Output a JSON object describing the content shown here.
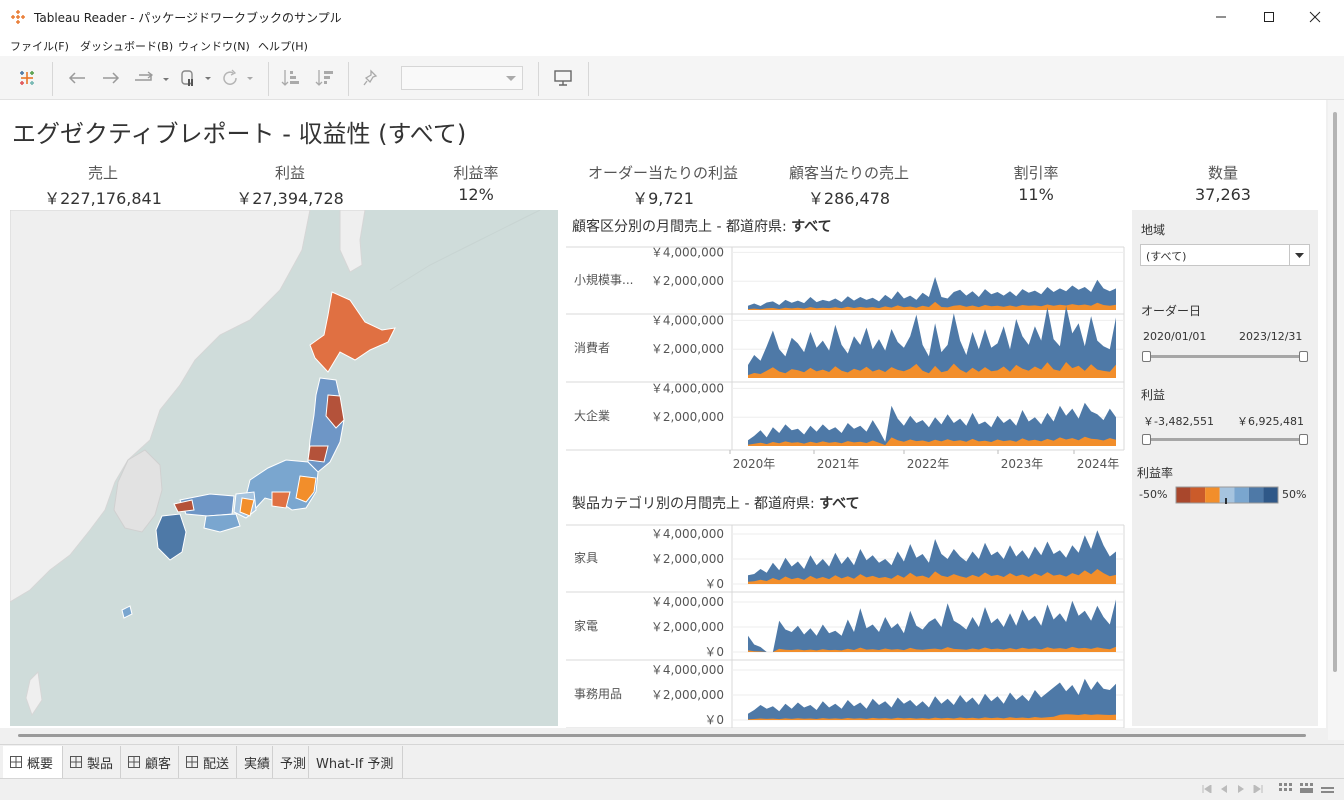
{
  "window": {
    "title": "Tableau Reader - パッケージドワークブックのサンプル"
  },
  "menu": [
    "ファイル(F)",
    "ダッシュボード(B)",
    "ウィンドウ(N)",
    "ヘルプ(H)"
  ],
  "dashboard": {
    "title": "エグゼクティブレポート - 収益性 (すべて)",
    "kpis": [
      {
        "label": "売上",
        "value": "￥227,176,841"
      },
      {
        "label": "利益",
        "value": "￥27,394,728"
      },
      {
        "label": "利益率",
        "value": "12%"
      },
      {
        "label": "オーダー当たりの利益",
        "value": "￥9,721"
      },
      {
        "label": "顧客当たりの売上",
        "value": "￥286,478"
      },
      {
        "label": "割引率",
        "value": "11%"
      },
      {
        "label": "数量",
        "value": "37,263"
      }
    ]
  },
  "colors": {
    "sales": "#4e79a7",
    "profit": "#f28e2b",
    "map_sea": "#cfdcda",
    "map_land": "#efefef"
  },
  "chart_data": [
    {
      "type": "area",
      "title": "顧客区分別の月間売上 - 都道府県: ",
      "title_bold": "すべて",
      "y_ticks": [
        "￥4,000,000",
        "￥2,000,000"
      ],
      "x_ticks": [
        "2020年",
        "2021年",
        "2022年",
        "2023年",
        "2024年"
      ],
      "ylim": [
        0,
        5000000
      ],
      "panels": [
        {
          "name": "小規模事...",
          "sales": [
            300000,
            450000,
            280000,
            520000,
            600000,
            350000,
            700000,
            500000,
            650000,
            480000,
            900000,
            550000,
            700000,
            600000,
            800000,
            550000,
            950000,
            650000,
            900000,
            700000,
            850000,
            600000,
            1050000,
            750000,
            1300000,
            800000,
            1000000,
            700000,
            1200000,
            900000,
            2300000,
            900000,
            800000,
            1250000,
            1400000,
            1000000,
            1300000,
            900000,
            1450000,
            1100000,
            1250000,
            1000000,
            1300000,
            950000,
            1450000,
            1200000,
            1350000,
            1100000,
            1600000,
            1250000,
            1500000,
            1300000,
            1700000,
            1400000,
            1600000,
            1250000,
            2100000,
            1500000,
            1300000,
            1500000
          ],
          "profit": [
            60000,
            100000,
            50000,
            120000,
            140000,
            70000,
            160000,
            110000,
            150000,
            100000,
            200000,
            120000,
            160000,
            130000,
            190000,
            120000,
            230000,
            140000,
            210000,
            160000,
            200000,
            130000,
            250000,
            170000,
            320000,
            190000,
            240000,
            150000,
            290000,
            210000,
            560000,
            210000,
            180000,
            300000,
            340000,
            230000,
            310000,
            200000,
            350000,
            260000,
            300000,
            230000,
            310000,
            220000,
            350000,
            290000,
            320000,
            260000,
            380000,
            300000,
            360000,
            310000,
            410000,
            330000,
            380000,
            300000,
            500000,
            350000,
            300000,
            360000
          ]
        },
        {
          "name": "消費者",
          "sales": [
            900000,
            1600000,
            1200000,
            2200000,
            3300000,
            2000000,
            1500000,
            2800000,
            2400000,
            1800000,
            3200000,
            2100000,
            2600000,
            1900000,
            3700000,
            2300000,
            1700000,
            2900000,
            2300000,
            3500000,
            2000000,
            2700000,
            1900000,
            3400000,
            2500000,
            2100000,
            2900000,
            4400000,
            2300000,
            1500000,
            3800000,
            1800000,
            2300000,
            4500000,
            2600000,
            1600000,
            3200000,
            2000000,
            3400000,
            2100000,
            2400000,
            3600000,
            2000000,
            4100000,
            2900000,
            2300000,
            3600000,
            2600000,
            4900000,
            2700000,
            2200000,
            5000000,
            3100000,
            3800000,
            2200000,
            4300000,
            2600000,
            2200000,
            2000000,
            4200000
          ],
          "profit": [
            200000,
            350000,
            280000,
            500000,
            750000,
            450000,
            330000,
            620000,
            540000,
            400000,
            700000,
            460000,
            580000,
            420000,
            820000,
            510000,
            380000,
            640000,
            510000,
            780000,
            450000,
            600000,
            420000,
            760000,
            560000,
            470000,
            650000,
            980000,
            510000,
            330000,
            840000,
            400000,
            510000,
            1000000,
            580000,
            360000,
            710000,
            440000,
            760000,
            470000,
            530000,
            800000,
            440000,
            910000,
            650000,
            510000,
            800000,
            580000,
            1090000,
            600000,
            490000,
            1110000,
            690000,
            850000,
            490000,
            960000,
            580000,
            490000,
            440000,
            930000
          ]
        },
        {
          "name": "大企業",
          "sales": [
            400000,
            700000,
            1100000,
            600000,
            1300000,
            900000,
            1500000,
            1100000,
            1200000,
            800000,
            1400000,
            1000000,
            1500000,
            1100000,
            1300000,
            900000,
            1600000,
            1200000,
            1400000,
            1000000,
            1800000,
            1100000,
            300000,
            2800000,
            1900000,
            1400000,
            2100000,
            1600000,
            1800000,
            1300000,
            2000000,
            1500000,
            2200000,
            1600000,
            1900000,
            1400000,
            2300000,
            1500000,
            1700000,
            1300000,
            2100000,
            1600000,
            1900000,
            1400000,
            2500000,
            1700000,
            2000000,
            1500000,
            2300000,
            1700000,
            2800000,
            2100000,
            2600000,
            1900000,
            3000000,
            2400000,
            2200000,
            1800000,
            2600000,
            2000000
          ],
          "profit": [
            80000,
            150000,
            230000,
            130000,
            280000,
            190000,
            320000,
            230000,
            260000,
            170000,
            300000,
            210000,
            320000,
            230000,
            280000,
            190000,
            340000,
            250000,
            300000,
            210000,
            380000,
            230000,
            60000,
            600000,
            400000,
            300000,
            450000,
            340000,
            380000,
            280000,
            430000,
            320000,
            470000,
            340000,
            400000,
            300000,
            490000,
            320000,
            360000,
            280000,
            450000,
            340000,
            400000,
            300000,
            530000,
            360000,
            430000,
            320000,
            490000,
            360000,
            600000,
            450000,
            550000,
            400000,
            640000,
            510000,
            470000,
            380000,
            550000,
            430000
          ]
        }
      ]
    },
    {
      "type": "area",
      "title": "製品カテゴリ別の月間売上 - 都道府県: ",
      "title_bold": "すべて",
      "y_ticks": [
        "￥4,000,000",
        "￥2,000,000",
        "￥0"
      ],
      "ylim": [
        0,
        4600000
      ],
      "panels": [
        {
          "name": "家具",
          "sales": [
            700000,
            800000,
            1200000,
            900000,
            1700000,
            1100000,
            2100000,
            1400000,
            1800000,
            1200000,
            2300000,
            1500000,
            2000000,
            1400000,
            2500000,
            1600000,
            2200000,
            1500000,
            2800000,
            1900000,
            2300000,
            1700000,
            2000000,
            1500000,
            2600000,
            1800000,
            3200000,
            2100000,
            2400000,
            1700000,
            3600000,
            2400000,
            2000000,
            2800000,
            2200000,
            1800000,
            2600000,
            2000000,
            3300000,
            2300000,
            2600000,
            2000000,
            3100000,
            2200000,
            2700000,
            2000000,
            3000000,
            2300000,
            3400000,
            2400000,
            2700000,
            2100000,
            3100000,
            2500000,
            3900000,
            2800000,
            4300000,
            3100000,
            2200000,
            2600000
          ],
          "profit": [
            180000,
            220000,
            340000,
            240000,
            480000,
            300000,
            600000,
            390000,
            500000,
            330000,
            650000,
            420000,
            560000,
            390000,
            700000,
            450000,
            620000,
            420000,
            790000,
            530000,
            650000,
            480000,
            560000,
            420000,
            730000,
            500000,
            900000,
            590000,
            670000,
            480000,
            1010000,
            670000,
            560000,
            790000,
            620000,
            500000,
            730000,
            560000,
            920000,
            640000,
            730000,
            560000,
            870000,
            620000,
            760000,
            560000,
            840000,
            640000,
            950000,
            670000,
            760000,
            590000,
            870000,
            700000,
            1090000,
            780000,
            1200000,
            870000,
            620000,
            730000
          ]
        },
        {
          "name": "家電",
          "sales": [
            1300000,
            600000,
            400000,
            0,
            0,
            2500000,
            1800000,
            1600000,
            2100000,
            1400000,
            1900000,
            1300000,
            2200000,
            1500000,
            1700000,
            1300000,
            2600000,
            1600000,
            3500000,
            1900000,
            2200000,
            1600000,
            2800000,
            1900000,
            2300000,
            1500000,
            3300000,
            2100000,
            1800000,
            2400000,
            2700000,
            2000000,
            3900000,
            2500000,
            2200000,
            1800000,
            2800000,
            2000000,
            3600000,
            2300000,
            2700000,
            2000000,
            3100000,
            2100000,
            3400000,
            2500000,
            2900000,
            2100000,
            3800000,
            2600000,
            3100000,
            2400000,
            4100000,
            2900000,
            3300000,
            2500000,
            3700000,
            2800000,
            2200000,
            4200000
          ],
          "profit": [
            130000,
            60000,
            40000,
            0,
            0,
            250000,
            180000,
            160000,
            210000,
            140000,
            190000,
            130000,
            220000,
            150000,
            170000,
            130000,
            260000,
            160000,
            350000,
            190000,
            220000,
            160000,
            280000,
            190000,
            230000,
            150000,
            330000,
            210000,
            180000,
            240000,
            270000,
            200000,
            390000,
            250000,
            220000,
            180000,
            280000,
            200000,
            360000,
            230000,
            270000,
            200000,
            310000,
            210000,
            340000,
            250000,
            290000,
            210000,
            380000,
            260000,
            310000,
            240000,
            410000,
            290000,
            330000,
            250000,
            370000,
            280000,
            220000,
            420000
          ]
        },
        {
          "name": "事務用品",
          "sales": [
            500000,
            800000,
            1200000,
            900000,
            1100000,
            700000,
            1300000,
            900000,
            1400000,
            1000000,
            1200000,
            800000,
            1500000,
            1000000,
            1300000,
            900000,
            1600000,
            1100000,
            1400000,
            900000,
            1700000,
            1200000,
            1500000,
            1000000,
            1800000,
            1300000,
            1600000,
            1100000,
            1500000,
            1000000,
            1900000,
            1300000,
            1700000,
            1200000,
            2000000,
            1400000,
            1800000,
            1200000,
            2100000,
            1500000,
            1900000,
            1300000,
            2200000,
            1600000,
            2000000,
            1500000,
            2400000,
            1800000,
            2200000,
            2600000,
            3000000,
            2300000,
            2800000,
            2000000,
            3300000,
            2400000,
            3100000,
            2500000,
            2400000,
            2900000
          ],
          "profit": [
            50000,
            80000,
            120000,
            90000,
            110000,
            70000,
            130000,
            90000,
            140000,
            100000,
            120000,
            80000,
            150000,
            100000,
            130000,
            90000,
            160000,
            110000,
            140000,
            90000,
            170000,
            120000,
            150000,
            100000,
            180000,
            130000,
            160000,
            110000,
            150000,
            100000,
            190000,
            130000,
            170000,
            120000,
            200000,
            140000,
            180000,
            120000,
            210000,
            150000,
            190000,
            130000,
            220000,
            160000,
            200000,
            150000,
            240000,
            180000,
            220000,
            260000,
            420000,
            460000,
            440000,
            400000,
            470000,
            410000,
            450000,
            420000,
            400000,
            430000
          ]
        }
      ]
    }
  ],
  "filters": {
    "region_label": "地域",
    "region_value": "(すべて)",
    "date_label": "オーダー日",
    "date_min": "2020/01/01",
    "date_max": "2023/12/31",
    "profit_label": "利益",
    "profit_min": "￥-3,482,551",
    "profit_max": "￥6,925,481",
    "margin_label": "利益率",
    "margin_min": "-50%",
    "margin_max": "50%",
    "margin_colors": [
      "#a9472c",
      "#cb5b2a",
      "#f28e2b",
      "#a6c4df",
      "#7aa6cf",
      "#4e79a7",
      "#2f5888"
    ]
  },
  "tabs": [
    {
      "label": "概要",
      "grid": true,
      "active": true
    },
    {
      "label": "製品",
      "grid": true
    },
    {
      "label": "顧客",
      "grid": true
    },
    {
      "label": "配送",
      "grid": true
    },
    {
      "label": "実績",
      "grid": false
    },
    {
      "label": "予測",
      "grid": false
    },
    {
      "label": "What-If 予測",
      "grid": false
    }
  ]
}
